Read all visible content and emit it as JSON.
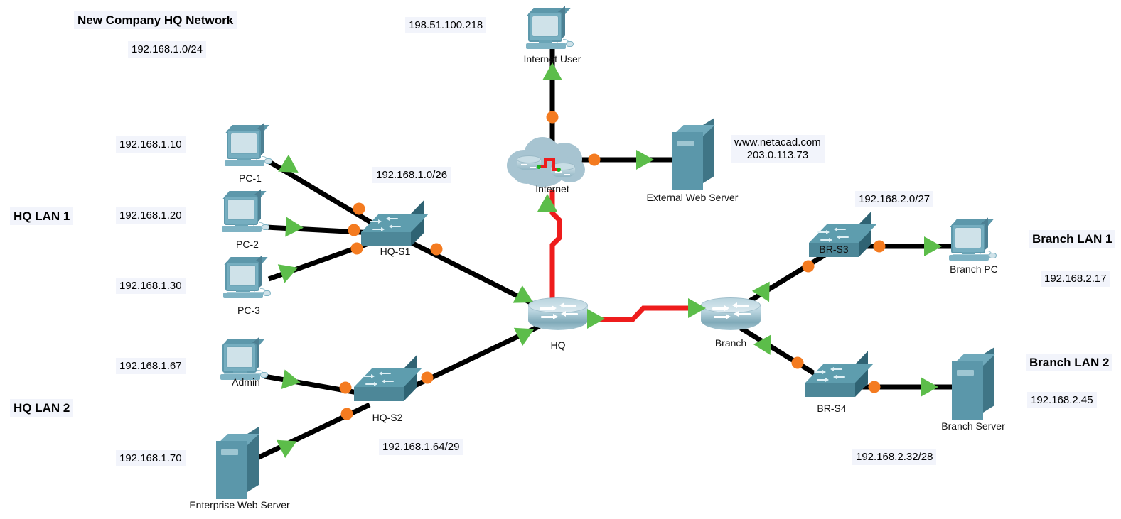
{
  "diagram": {
    "title": "New Company HQ Network",
    "zone_labels": [
      {
        "id": "hq-lan-1",
        "text": "HQ LAN 1"
      },
      {
        "id": "hq-lan-2",
        "text": "HQ LAN 2"
      },
      {
        "id": "branch-lan-1",
        "text": "Branch LAN 1"
      },
      {
        "id": "branch-lan-2",
        "text": "Branch LAN 2"
      }
    ],
    "network_labels": [
      {
        "id": "hq-supernet",
        "text": "192.168.1.0/24"
      },
      {
        "id": "hq-lan1-net",
        "text": "192.168.1.0/26"
      },
      {
        "id": "hq-lan2-net",
        "text": "192.168.1.64/29"
      },
      {
        "id": "br-lan1-net",
        "text": "192.168.2.0/27"
      },
      {
        "id": "br-lan2-net",
        "text": "192.168.2.32/28"
      }
    ],
    "host_addresses": [
      {
        "id": "pc1-ip",
        "text": "192.168.1.10"
      },
      {
        "id": "pc2-ip",
        "text": "192.168.1.20"
      },
      {
        "id": "pc3-ip",
        "text": "192.168.1.30"
      },
      {
        "id": "admin-ip",
        "text": "192.168.1.67"
      },
      {
        "id": "ews-ip",
        "text": "192.168.1.70"
      },
      {
        "id": "iu-ip",
        "text": "198.51.100.218"
      },
      {
        "id": "brpc-ip",
        "text": "192.168.2.17"
      },
      {
        "id": "brsrv-ip",
        "text": "192.168.2.45"
      }
    ],
    "external_server_label": {
      "domain": "www.netacad.com",
      "ip": "203.0.113.73"
    },
    "devices": [
      {
        "id": "pc1",
        "name": "PC-1",
        "type": "pc"
      },
      {
        "id": "pc2",
        "name": "PC-2",
        "type": "pc"
      },
      {
        "id": "pc3",
        "name": "PC-3",
        "type": "pc"
      },
      {
        "id": "admin",
        "name": "Admin",
        "type": "pc"
      },
      {
        "id": "ews",
        "name": "Enterprise Web Server",
        "type": "server"
      },
      {
        "id": "hqs1",
        "name": "HQ-S1",
        "type": "switch"
      },
      {
        "id": "hqs2",
        "name": "HQ-S2",
        "type": "switch"
      },
      {
        "id": "hq",
        "name": "HQ",
        "type": "router"
      },
      {
        "id": "internet",
        "name": "Internet",
        "type": "cloud"
      },
      {
        "id": "iuser",
        "name": "Internet User",
        "type": "pc"
      },
      {
        "id": "extsrv",
        "name": "External Web Server",
        "type": "server"
      },
      {
        "id": "branch",
        "name": "Branch",
        "type": "router"
      },
      {
        "id": "brs3",
        "name": "BR-S3",
        "type": "switch"
      },
      {
        "id": "brs4",
        "name": "BR-S4",
        "type": "switch"
      },
      {
        "id": "brpc",
        "name": "Branch PC",
        "type": "pc"
      },
      {
        "id": "brsrv",
        "name": "Branch Server",
        "type": "server"
      }
    ],
    "colors": {
      "ethernet_link": "#000000",
      "serial_link": "#ee1c1c",
      "link_dot": "#f47b20",
      "link_arrow": "#5cbd4a",
      "device_teal": "#4d8798",
      "label_bg": "#f2f4fb"
    }
  }
}
